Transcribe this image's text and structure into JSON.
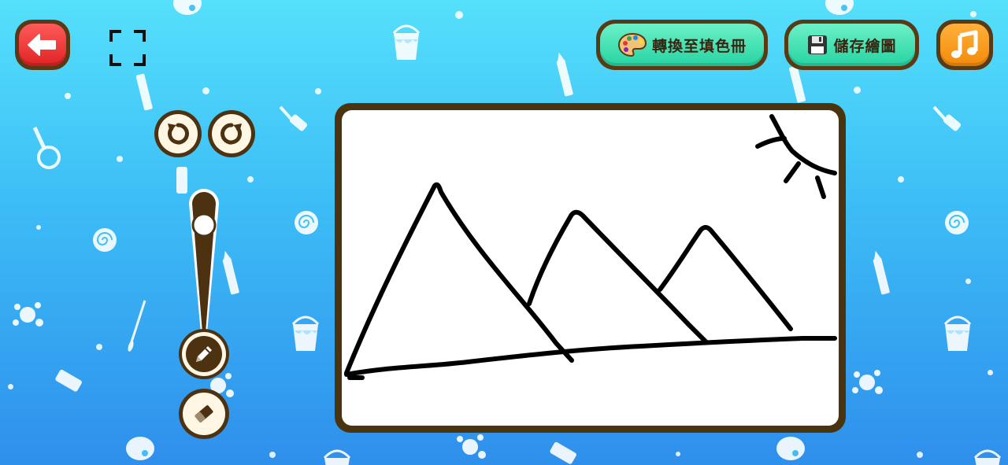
{
  "toolbar": {
    "convert_label": "轉換至填色冊",
    "save_label": "儲存繪圖"
  },
  "icons": {
    "back": "back-arrow-icon",
    "fullscreen": "fullscreen-icon",
    "palette": "palette-icon",
    "save": "floppy-disk-icon",
    "music": "music-note-icon",
    "undo": "undo-icon",
    "redo": "redo-icon",
    "pen": "pencil-icon",
    "eraser": "eraser-icon"
  },
  "colors": {
    "background_top": "#55e0fb",
    "background_bottom": "#2f8fec",
    "frame_brown": "#4a3410",
    "button_green": "#26d3a2",
    "button_red": "#e02323",
    "button_orange": "#f28a0a",
    "ink": "#000000"
  },
  "brush": {
    "selected_tool": "pen",
    "size_level": 0.82
  }
}
